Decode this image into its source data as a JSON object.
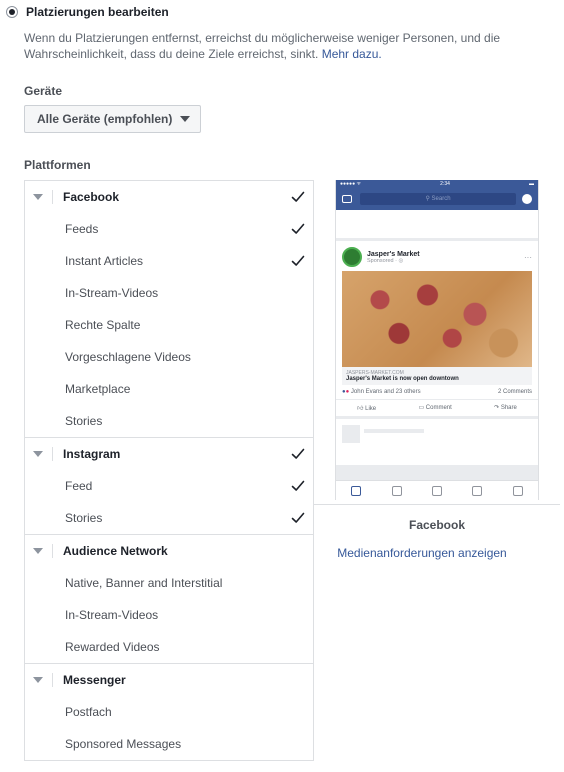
{
  "placement": {
    "option_label": "Platzierungen bearbeiten",
    "description": "Wenn du Platzierungen entfernst, erreichst du möglicherweise weniger Personen, und die Wahrscheinlichkeit, dass du deine Ziele erreichst, sinkt.",
    "more_link": "Mehr dazu."
  },
  "devices": {
    "label": "Geräte",
    "selected": "Alle Geräte (empfohlen)"
  },
  "platforms": {
    "label": "Plattformen",
    "groups": [
      {
        "name": "Facebook",
        "checked": true,
        "items": [
          {
            "label": "Feeds",
            "checked": true
          },
          {
            "label": "Instant Articles",
            "checked": true
          },
          {
            "label": "In-Stream-Videos",
            "checked": false
          },
          {
            "label": "Rechte Spalte",
            "checked": false
          },
          {
            "label": "Vorgeschlagene Videos",
            "checked": false
          },
          {
            "label": "Marketplace",
            "checked": false
          },
          {
            "label": "Stories",
            "checked": false
          }
        ]
      },
      {
        "name": "Instagram",
        "checked": true,
        "items": [
          {
            "label": "Feed",
            "checked": true
          },
          {
            "label": "Stories",
            "checked": true
          }
        ]
      },
      {
        "name": "Audience Network",
        "checked": false,
        "items": [
          {
            "label": "Native, Banner and Interstitial",
            "checked": false
          },
          {
            "label": "In-Stream-Videos",
            "checked": false
          },
          {
            "label": "Rewarded Videos",
            "checked": false
          }
        ]
      },
      {
        "name": "Messenger",
        "checked": false,
        "items": [
          {
            "label": "Postfach",
            "checked": false
          },
          {
            "label": "Sponsored Messages",
            "checked": false
          }
        ]
      }
    ]
  },
  "preview": {
    "status_time": "2:34",
    "status_carrier": "●●●●● ᯤ",
    "search_placeholder": "Search",
    "page_name": "Jasper's Market",
    "sponsored": "Sponsored · ◎",
    "link_domain": "JASPERS-MARKET.COM",
    "link_title": "Jasper's Market is now open downtown",
    "reactions_text": "John Evans and 23 others",
    "comments_text": "2 Comments",
    "action_like": "Like",
    "action_comment": "Comment",
    "action_share": "Share",
    "title": "Facebook",
    "media_link": "Medienanforderungen anzeigen"
  },
  "colors": {
    "brand": "#3b5998",
    "link": "#365899"
  }
}
